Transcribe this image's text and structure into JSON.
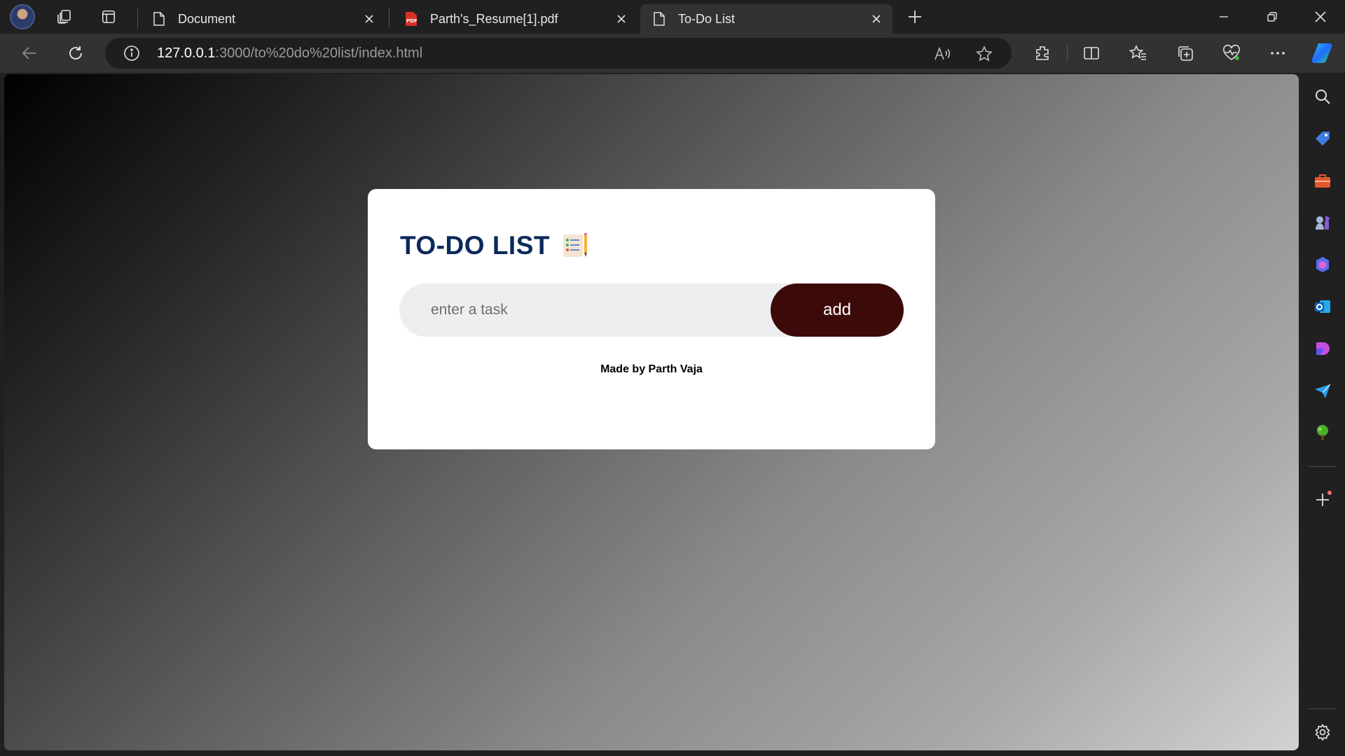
{
  "browser": {
    "tabs": [
      {
        "label": "Document",
        "icon": "page-icon",
        "active": false
      },
      {
        "label": "Parth's_Resume[1].pdf",
        "icon": "pdf-icon",
        "active": false
      },
      {
        "label": "To-Do List",
        "icon": "page-icon",
        "active": true
      }
    ],
    "address": {
      "host": "127.0.0.1",
      "path": ":3000/to%20do%20list/index.html"
    }
  },
  "app": {
    "title": "TO-DO LIST",
    "input_placeholder": "enter a task",
    "add_label": "add",
    "credit": "Made by Parth Vaja"
  },
  "colors": {
    "title": "#0b2a5a",
    "add_button": "#3d0a0a",
    "input_bg": "#edeef0"
  }
}
